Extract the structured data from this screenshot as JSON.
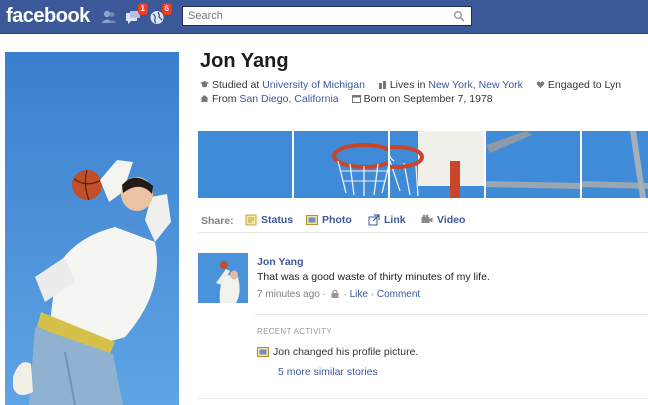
{
  "topbar": {
    "logo": "facebook",
    "friend_requests_badge": "",
    "messages_badge": "1",
    "notifications_badge": "6",
    "search_placeholder": "Search",
    "brand_color": "#3b5998"
  },
  "profile": {
    "name": "Jon Yang",
    "info_line1": {
      "studied_prefix": "Studied at",
      "school": "University of Michigan",
      "lives_prefix": "Lives in",
      "city": "New York, New York",
      "relationship": "Engaged to Lyn"
    },
    "info_line2": {
      "from_prefix": "From",
      "hometown": "San Diego, California",
      "born": "Born on September 7, 1978"
    }
  },
  "share": {
    "label": "Share:",
    "items": [
      {
        "label": "Status",
        "icon": "status-icon"
      },
      {
        "label": "Photo",
        "icon": "photo-icon"
      },
      {
        "label": "Link",
        "icon": "link-icon"
      },
      {
        "label": "Video",
        "icon": "video-icon"
      }
    ]
  },
  "post": {
    "author": "Jon Yang",
    "text": "That was a good waste of thirty minutes of my life.",
    "time": "7 minutes ago",
    "like": "Like",
    "comment": "Comment"
  },
  "recent_activity": {
    "heading": "RECENT ACTIVITY",
    "item": "Jon changed his profile picture.",
    "more": "5 more similar stories"
  }
}
